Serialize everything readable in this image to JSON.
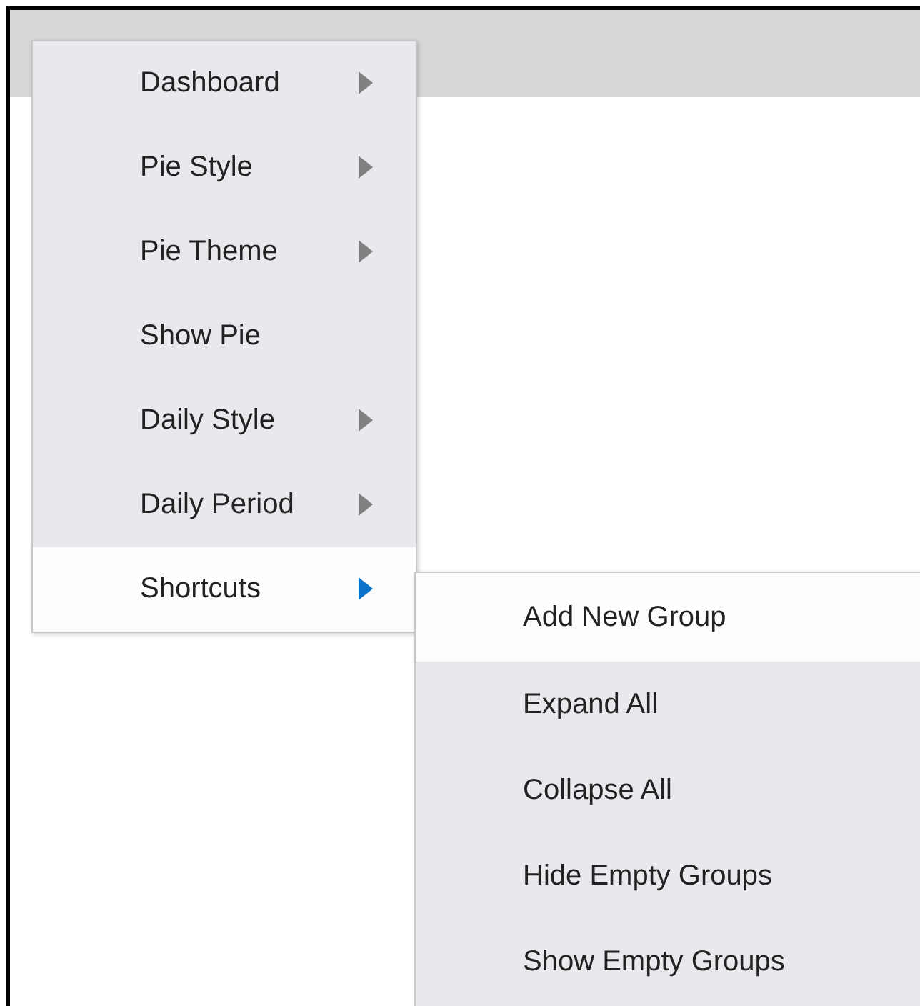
{
  "menu": {
    "items": [
      {
        "label": "Dashboard",
        "has_submenu": true,
        "selected": false
      },
      {
        "label": "Pie Style",
        "has_submenu": true,
        "selected": false
      },
      {
        "label": "Pie Theme",
        "has_submenu": true,
        "selected": false
      },
      {
        "label": "Show Pie",
        "has_submenu": false,
        "selected": false
      },
      {
        "label": "Daily Style",
        "has_submenu": true,
        "selected": false
      },
      {
        "label": "Daily Period",
        "has_submenu": true,
        "selected": false
      },
      {
        "label": "Shortcuts",
        "has_submenu": true,
        "selected": true
      }
    ]
  },
  "submenu": {
    "items": [
      {
        "label": "Add New Group",
        "selected": true
      },
      {
        "label": "Expand All",
        "selected": false
      },
      {
        "label": "Collapse All",
        "selected": false
      },
      {
        "label": "Hide Empty Groups",
        "selected": false
      },
      {
        "label": "Show Empty Groups",
        "selected": false
      }
    ]
  }
}
